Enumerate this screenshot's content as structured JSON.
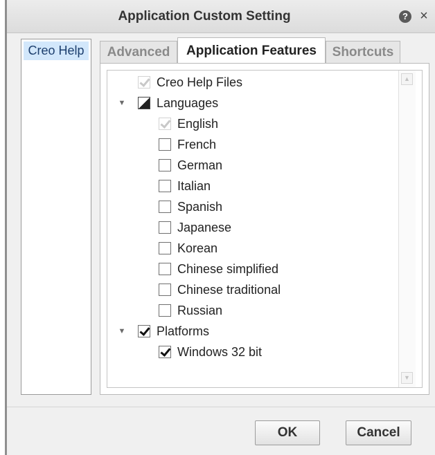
{
  "dialog": {
    "title": "Application Custom Setting",
    "help_icon": "question-mark-icon",
    "help_glyph": "?",
    "close_icon": "close-x-icon",
    "close_glyph": "×"
  },
  "left_panel": {
    "items": [
      {
        "label": "Creo Help",
        "selected": true
      }
    ]
  },
  "tabs": [
    {
      "label": "Advanced",
      "active": false
    },
    {
      "label": "Application Features",
      "active": true
    },
    {
      "label": "Shortcuts",
      "active": false
    }
  ],
  "tree": {
    "expander_glyph": "▼",
    "scroll_up_glyph": "▲",
    "scroll_down_glyph": "▼",
    "items": [
      {
        "label": "Creo Help Files",
        "state": "checked-disabled"
      },
      {
        "label": "Languages",
        "state": "partial",
        "expanded": true,
        "children": [
          {
            "label": "English",
            "state": "checked-disabled"
          },
          {
            "label": "French",
            "state": "unchecked"
          },
          {
            "label": "German",
            "state": "unchecked"
          },
          {
            "label": "Italian",
            "state": "unchecked"
          },
          {
            "label": "Spanish",
            "state": "unchecked"
          },
          {
            "label": "Japanese",
            "state": "unchecked"
          },
          {
            "label": "Korean",
            "state": "unchecked"
          },
          {
            "label": "Chinese simplified",
            "state": "unchecked"
          },
          {
            "label": "Chinese traditional",
            "state": "unchecked"
          },
          {
            "label": "Russian",
            "state": "unchecked"
          }
        ]
      },
      {
        "label": "Platforms",
        "state": "checked",
        "expanded": true,
        "children": [
          {
            "label": "Windows 32 bit",
            "state": "checked"
          }
        ]
      }
    ]
  },
  "buttons": {
    "ok": "OK",
    "cancel": "Cancel"
  },
  "colors": {
    "selection": "#d2e7fb",
    "window_bg": "#f0f0f0"
  }
}
